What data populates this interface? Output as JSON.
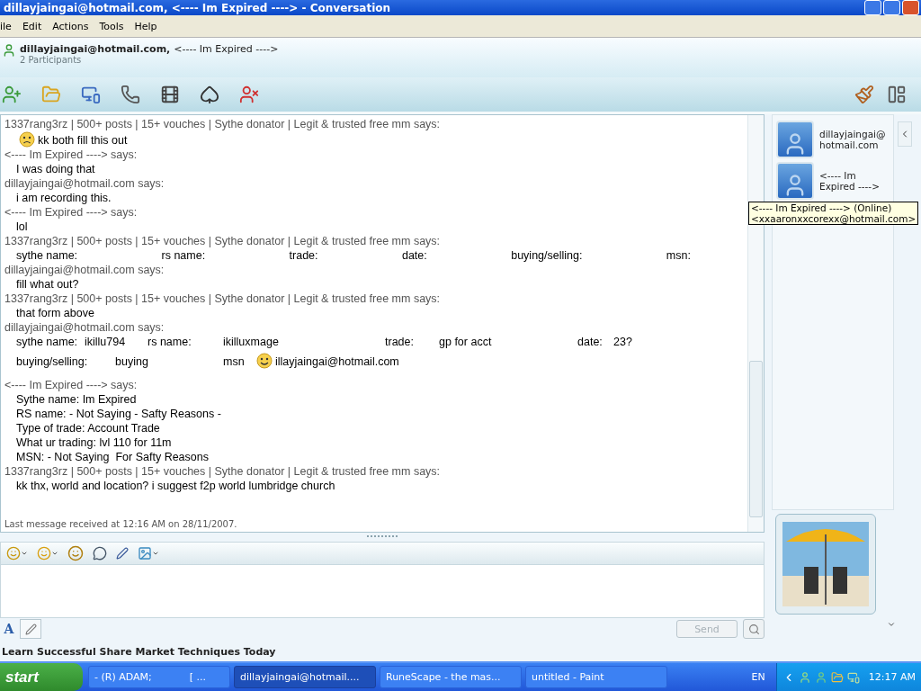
{
  "window": {
    "title": "dillayjaingai@hotmail.com, <---- Im Expired ----> - Conversation"
  },
  "menu": [
    "ile",
    "Edit",
    "Actions",
    "Tools",
    "Help"
  ],
  "header": {
    "participants_line": "dillayjaingai@hotmail.com,",
    "participant_second": "<---- Im Expired ---->",
    "count": "2 Participants"
  },
  "messages": [
    {
      "sender": "1337rang3rz | 500+ posts | 15+ vouches | Sythe donator | Legit & trusted free mm says:",
      "lines": [
        {
          "kind": "plain",
          "parts": [
            {
              "kind": "frown"
            },
            {
              "kind": "text",
              "text": "kk both fill this out"
            }
          ]
        }
      ]
    },
    {
      "sender": "<---- Im Expired ----> says:",
      "lines": [
        {
          "kind": "plain",
          "parts": [
            {
              "kind": "text",
              "text": "I was doing that"
            }
          ]
        }
      ]
    },
    {
      "sender": "dillayjaingai@hotmail.com says:",
      "lines": [
        {
          "kind": "plain",
          "parts": [
            {
              "kind": "text",
              "text": "i am recording this."
            }
          ]
        }
      ]
    },
    {
      "sender": "<---- Im Expired ----> says:",
      "lines": [
        {
          "kind": "plain",
          "parts": [
            {
              "kind": "text",
              "text": "lol"
            }
          ]
        }
      ]
    },
    {
      "sender": "1337rang3rz | 500+ posts | 15+ vouches | Sythe donator | Legit & trusted free mm says:",
      "lines": [
        {
          "kind": "spread",
          "parts": [
            {
              "kind": "text",
              "text": "sythe name:"
            },
            {
              "kind": "text",
              "text": "rs name:"
            },
            {
              "kind": "text",
              "text": "trade:"
            },
            {
              "kind": "text",
              "text": "date:"
            },
            {
              "kind": "text",
              "text": "buying/selling:"
            },
            {
              "kind": "text",
              "text": "msn:"
            }
          ]
        }
      ]
    },
    {
      "sender": "dillayjaingai@hotmail.com says:",
      "lines": [
        {
          "kind": "plain",
          "parts": [
            {
              "kind": "text",
              "text": "fill what out?"
            }
          ]
        }
      ]
    },
    {
      "sender": "1337rang3rz | 500+ posts | 15+ vouches | Sythe donator | Legit & trusted free mm says:",
      "lines": [
        {
          "kind": "plain",
          "parts": [
            {
              "kind": "text",
              "text": "that form above"
            }
          ]
        }
      ]
    },
    {
      "sender": "dillayjaingai@hotmail.com says:",
      "lines": [
        {
          "kind": "form1",
          "parts": [
            {
              "kind": "text",
              "text": "sythe name:"
            },
            {
              "kind": "text",
              "text": "ikillu794"
            },
            {
              "kind": "text",
              "text": "rs name:"
            },
            {
              "kind": "text",
              "text": "ikilluxmage"
            },
            {
              "kind": "text",
              "text": "trade:"
            },
            {
              "kind": "text",
              "text": "gp for acct"
            },
            {
              "kind": "text",
              "text": "date:"
            },
            {
              "kind": "text",
              "text": "23?"
            }
          ]
        },
        {
          "kind": "form2",
          "parts": [
            {
              "kind": "text",
              "text": "buying/selling:"
            },
            {
              "kind": "text",
              "text": "buying"
            },
            {
              "kind": "text",
              "text": "msn"
            },
            {
              "kind": "smile"
            },
            {
              "kind": "text",
              "text": "illayjaingai@hotmail.com"
            }
          ]
        },
        {
          "kind": "blank"
        }
      ]
    },
    {
      "sender": "<---- Im Expired ----> says:",
      "lines": [
        {
          "kind": "plain",
          "parts": [
            {
              "kind": "text",
              "text": "Sythe name: Im Expired"
            }
          ]
        },
        {
          "kind": "plain",
          "parts": [
            {
              "kind": "text",
              "text": "RS name: - Not Saying - Safty Reasons -"
            }
          ]
        },
        {
          "kind": "plain",
          "parts": [
            {
              "kind": "text",
              "text": "Type of trade: Account Trade"
            }
          ]
        },
        {
          "kind": "plain",
          "parts": [
            {
              "kind": "text",
              "text": "What ur trading: lvl 110 for 11m"
            }
          ]
        },
        {
          "kind": "plain",
          "parts": [
            {
              "kind": "text",
              "text": "MSN: - Not Saying  For Safty Reasons"
            }
          ]
        }
      ]
    },
    {
      "sender": "1337rang3rz | 500+ posts | 15+ vouches | Sythe donator | Legit & trusted free mm says:",
      "lines": [
        {
          "kind": "plain",
          "parts": [
            {
              "kind": "text",
              "text": "kk thx, world and location? i suggest f2p world lumbridge church"
            }
          ]
        }
      ]
    }
  ],
  "last_message": "Last message received at 12:16 AM on 28/11/2007.",
  "contacts": [
    {
      "name": "dillayjaingai@hotmail.com"
    },
    {
      "name": "<---- Im Expired ---->"
    }
  ],
  "tooltip": {
    "line1": "<---- Im Expired ----> (Online)",
    "line2": "<xxaaronxxcorexx@hotmail.com>"
  },
  "font_button": "A",
  "send_button": {
    "label": "Send",
    "disabled": true
  },
  "ad": "Learn Successful Share Market Techniques Today",
  "taskbar": {
    "start": "start",
    "tasks": [
      {
        "label": "- (R) ADAM;            [ ...",
        "selected": false
      },
      {
        "label": "dillayjaingai@hotmail....",
        "selected": true
      },
      {
        "label": "RuneScape - the mas...",
        "selected": false
      },
      {
        "label": "untitled - Paint",
        "selected": false
      }
    ],
    "language": "EN",
    "clock": "12:17 AM"
  }
}
